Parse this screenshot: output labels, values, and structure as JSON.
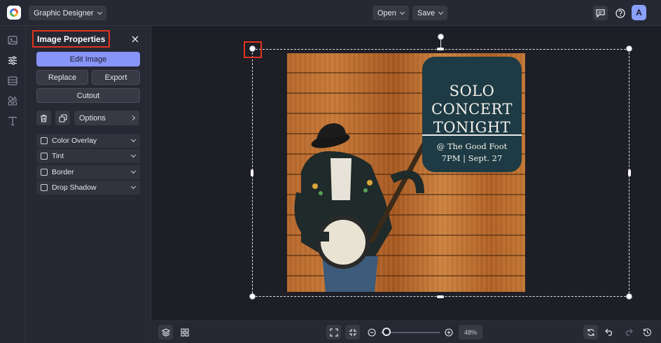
{
  "topbar": {
    "app_menu_label": "Graphic Designer",
    "open_label": "Open",
    "save_label": "Save",
    "avatar_initial": "A"
  },
  "rail": {
    "icons": [
      "image-icon",
      "sliders-icon",
      "layout-icon",
      "shapes-icon",
      "text-icon"
    ]
  },
  "panel": {
    "title": "Image Properties",
    "edit_image_label": "Edit Image",
    "replace_label": "Replace",
    "export_label": "Export",
    "cutout_label": "Cutout",
    "options_label": "Options",
    "effects": [
      {
        "label": "Color Overlay",
        "checked": false
      },
      {
        "label": "Tint",
        "checked": false
      },
      {
        "label": "Border",
        "checked": false
      },
      {
        "label": "Drop Shadow",
        "checked": false
      }
    ]
  },
  "poster": {
    "headline": [
      "SOLO",
      "CONCERT",
      "TONIGHT"
    ],
    "venue": "@ The Good Foot",
    "datetime": "7PM | Sept. 27"
  },
  "bottombar": {
    "zoom_percent": "48%",
    "zoom_level": 0.1
  },
  "colors": {
    "accent": "#8794f8",
    "highlight": "#e1341e",
    "tile": "#1e3b45",
    "avatar": "#8aa0ff"
  }
}
